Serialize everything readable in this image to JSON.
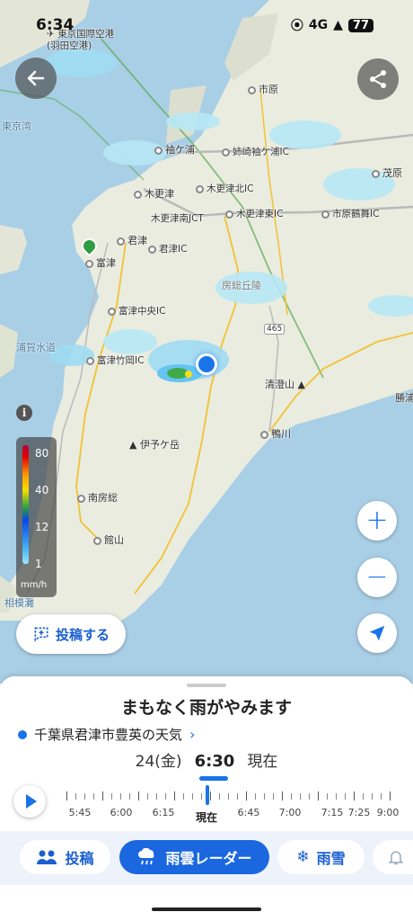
{
  "status_bar": {
    "time": "6:34",
    "network": "4G",
    "battery": "77"
  },
  "map": {
    "places": [
      {
        "id": "haneda",
        "label": "東京国際空港\n(羽田空港)"
      },
      {
        "id": "ichihara",
        "label": "市原"
      },
      {
        "id": "sodegaura",
        "label": "袖ケ浦"
      },
      {
        "id": "anesaki",
        "label": "姉崎袖ケ浦IC"
      },
      {
        "id": "kisarazu",
        "label": "木更津"
      },
      {
        "id": "kisarazukita",
        "label": "木更津北IC"
      },
      {
        "id": "kisarazujct",
        "label": "木更津南JCT"
      },
      {
        "id": "kisarazuhigashi",
        "label": "木更津東IC"
      },
      {
        "id": "ichiharatsurumai",
        "label": "市原鶴舞IC"
      },
      {
        "id": "kimitsu",
        "label": "君津"
      },
      {
        "id": "kimitsuic",
        "label": "君津IC"
      },
      {
        "id": "futtsu",
        "label": "富津"
      },
      {
        "id": "futtsuchuo",
        "label": "富津中央IC"
      },
      {
        "id": "futtsutakeoka",
        "label": "富津竹岡IC"
      },
      {
        "id": "kiyosumiyama",
        "label": "清澄山"
      },
      {
        "id": "kamogawa",
        "label": "鴨川"
      },
      {
        "id": "iyogatake",
        "label": "伊予ケ岳"
      },
      {
        "id": "minamiboso",
        "label": "南房総"
      },
      {
        "id": "tateyama",
        "label": "館山"
      },
      {
        "id": "mobara",
        "label": "茂原"
      },
      {
        "id": "katsuura",
        "label": "勝浦"
      },
      {
        "id": "tokyowan",
        "label": "東京湾"
      },
      {
        "id": "uragasuido",
        "label": "浦賀水道"
      },
      {
        "id": "bosokyuryo",
        "label": "房総丘陵"
      },
      {
        "id": "sagaminada",
        "label": "相模灘"
      }
    ],
    "legend": {
      "labels": [
        "80",
        "40",
        "12",
        "1"
      ],
      "unit": "mm/h"
    },
    "post_button_label": "投稿する",
    "colors": {
      "accent": "#1a73e8",
      "sea": "#a9cfe6",
      "land": "#e9ecdf"
    }
  },
  "sheet": {
    "headline": "まもなく雨がやみます",
    "location": "千葉県君津市豊英の天気",
    "date": "24(金)",
    "time": "6:30",
    "now_label": "現在",
    "timeline_labels": [
      "5:45",
      "6:00",
      "6:15",
      "現在",
      "6:45",
      "7:00",
      "7:15",
      "7:25",
      "9:00"
    ]
  },
  "nav": {
    "tabs": [
      {
        "label": "投稿",
        "icon": "people-icon"
      },
      {
        "label": "雨雲レーダー",
        "icon": "rain-cloud-icon",
        "active": true
      },
      {
        "label": "雨雪",
        "icon": "snow-icon"
      },
      {
        "label": "",
        "icon": "bell-icon"
      }
    ]
  }
}
